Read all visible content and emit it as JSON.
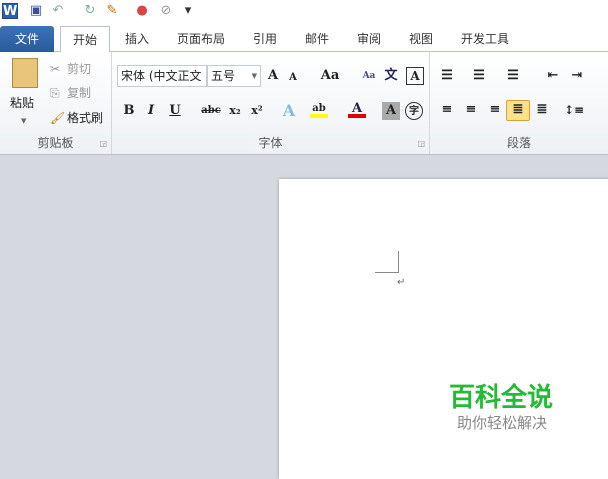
{
  "qat": {
    "word_icon": "W",
    "items": [
      "save-icon",
      "undo-icon",
      "redo-icon",
      "format-painter-icon",
      "color-icon",
      "clear-icon",
      "customize-icon"
    ]
  },
  "tabs": [
    "文件",
    "开始",
    "插入",
    "页面布局",
    "引用",
    "邮件",
    "审阅",
    "视图",
    "开发工具"
  ],
  "clipboard": {
    "paste": "粘贴",
    "cut": "剪切",
    "copy": "复制",
    "format_painter": "格式刷",
    "label": "剪贴板"
  },
  "font": {
    "name": "宋体 (中文正文",
    "size": "五号",
    "grow": "A",
    "shrink": "A",
    "case": "Aa",
    "bold": "B",
    "italic": "I",
    "underline": "U",
    "strike": "abc",
    "sub": "x₂",
    "sup": "x²",
    "label": "字体",
    "phonetic": "文",
    "border": "A",
    "enclose": "字",
    "highlight": "ab",
    "font_color": "A",
    "shading": "A",
    "highlight_color": "#ffff00",
    "font_color_value": "#e00000"
  },
  "paragraph": {
    "label": "段落"
  },
  "document": {
    "mark": "↵"
  },
  "watermark": {
    "title": "百科全说",
    "subtitle": "助你轻松解决",
    "color": "#22bb33"
  }
}
